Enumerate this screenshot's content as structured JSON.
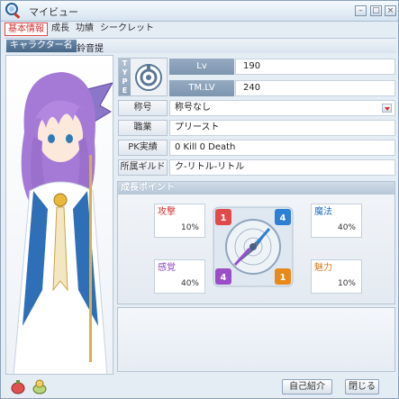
{
  "window": {
    "title": "マイビュー"
  },
  "tabs": [
    "基本情報",
    "成長",
    "功績",
    "シークレット"
  ],
  "character": {
    "name_label": "キャラクター名",
    "name": "鈴音提"
  },
  "type_box": {
    "label": "TYPE",
    "emblem_icon": "type-emblem-icon"
  },
  "stats": [
    {
      "label": "Lv",
      "value": "190"
    },
    {
      "label": "TM.LV",
      "value": "240"
    }
  ],
  "profile_rows": {
    "title": {
      "label": "称号",
      "value": "称号なし"
    },
    "job": {
      "label": "職業",
      "value": "プリースト"
    },
    "pk": {
      "label": "PK実績",
      "value": "0 Kill  0 Death"
    },
    "guild": {
      "label": "所属ギルド",
      "value": "ク-リトル-リトル"
    }
  },
  "growth": {
    "title": "成長ポイント",
    "cards": [
      {
        "name": "攻撃",
        "value": "10%",
        "color": "#e04a4a"
      },
      {
        "name": "魔法",
        "value": "40%",
        "color": "#2c7fd4"
      },
      {
        "name": "感覚",
        "value": "40%",
        "color": "#9a4fc8"
      },
      {
        "name": "魅力",
        "value": "10%",
        "color": "#e8891c"
      }
    ],
    "compass_numbers": [
      "1",
      "4",
      "4",
      "1"
    ]
  },
  "footer": {
    "intro_button": "自己紹介",
    "close_button": "閉じる"
  }
}
